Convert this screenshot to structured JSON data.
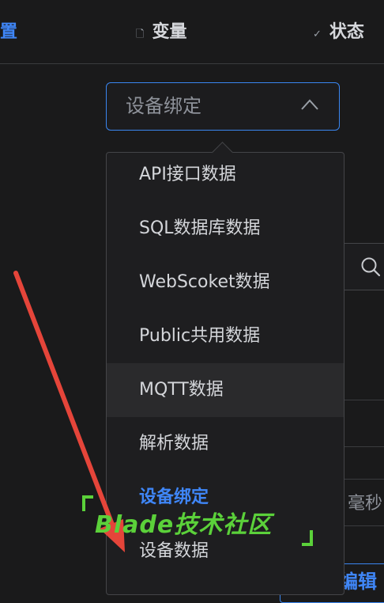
{
  "tabs": {
    "config": "置",
    "variables": "变量",
    "status": "状态"
  },
  "select": {
    "value": "设备绑定"
  },
  "dropdown": {
    "options": [
      "API接口数据",
      "SQL数据库数据",
      "WebScoket数据",
      "Public共用数据",
      "MQTT数据",
      "解析数据",
      "设备绑定",
      "设备数据"
    ],
    "hovered": "MQTT数据",
    "selected": "设备绑定"
  },
  "background": {
    "ms_label": "毫秒",
    "edit_label": "编辑"
  },
  "watermark": "Blade技术社区",
  "colors": {
    "accent": "#3f86f7",
    "watermark": "#5bd13a",
    "arrow": "#e5453a"
  }
}
